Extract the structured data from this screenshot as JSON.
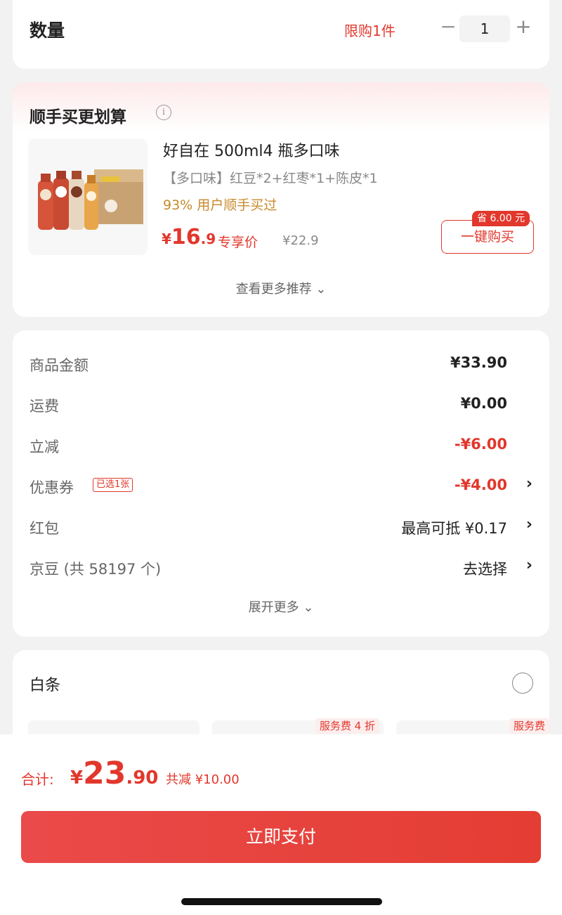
{
  "quantity": {
    "label": "数量",
    "limit": "限购1件",
    "minus": "−",
    "value": "1",
    "plus": "+"
  },
  "recommend": {
    "title": "顺手买更划算",
    "info": "i",
    "product": {
      "name": "好自在 500ml4 瓶多口味",
      "spec": "【多口味】红豆*2+红枣*1+陈皮*1",
      "bought": "93% 用户顺手买过",
      "price_symbol": "¥",
      "price_int": "16",
      "price_dec": ".9",
      "exclusive": "专享价",
      "original_price": "¥22.9",
      "save_badge": "省 6.00 元",
      "buy_button": "一键购买"
    },
    "more": "查看更多推荐 ⌄"
  },
  "summary": {
    "rows": [
      {
        "label": "商品金额",
        "value": "¥33.90"
      },
      {
        "label": "运费",
        "value": "¥0.00"
      },
      {
        "label": "立减",
        "value": "-¥6.00"
      },
      {
        "label": "优惠券",
        "tag": "已选1张",
        "value": "-¥4.00",
        "arrow": "›"
      },
      {
        "label": "红包",
        "value": "最高可抵 ¥0.17",
        "arrow": "›"
      },
      {
        "label": "京豆 (共 58197 个)",
        "value": "去选择",
        "arrow": "›"
      }
    ],
    "expand": "展开更多 ⌄"
  },
  "baitiao": {
    "label": "白条",
    "plans": [
      {
        "tag": ""
      },
      {
        "tag": "服务费 4 折"
      },
      {
        "tag": "服务费"
      }
    ]
  },
  "footer": {
    "total_label": "合计:",
    "total_symbol": "¥",
    "total_int": "23",
    "total_dec": ".90",
    "total_save": "共减 ¥10.00",
    "pay_button": "立即支付"
  },
  "colors": {
    "accent": "#e2372c",
    "gold": "#c8892c"
  }
}
